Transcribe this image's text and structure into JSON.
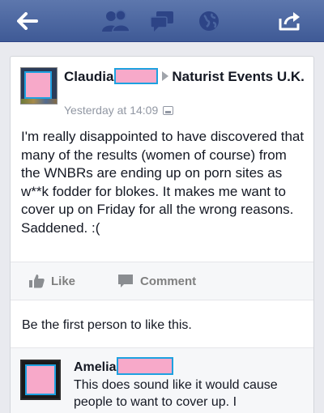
{
  "topbar": {
    "icons": [
      "back-arrow-icon",
      "friends-icon",
      "messages-icon",
      "globe-icon",
      "share-icon"
    ],
    "colors": {
      "bar": "#4a65a0",
      "icon": "#ffffff",
      "dim_icon": "#2d4486"
    }
  },
  "post": {
    "author_first": "Claudia",
    "target": "Naturist Events U.K.",
    "timestamp": "Yesterday at 14:09",
    "body": "I'm really disappointed to have discovered that many of the results (women of course) from the WNBRs are ending up on porn sites as w**k fodder for blokes. It makes me want to cover up on Friday for all the wrong reasons. Saddened. :(",
    "actions": {
      "like": "Like",
      "comment": "Comment"
    },
    "likes_summary": "Be the first person to like this."
  },
  "comment": {
    "author_first": "Amelia",
    "text": "This does sound like it would cause people to want to cover up. I"
  },
  "colors": {
    "redaction_fill": "#f7a9c9",
    "redaction_border": "#1da1e0"
  }
}
